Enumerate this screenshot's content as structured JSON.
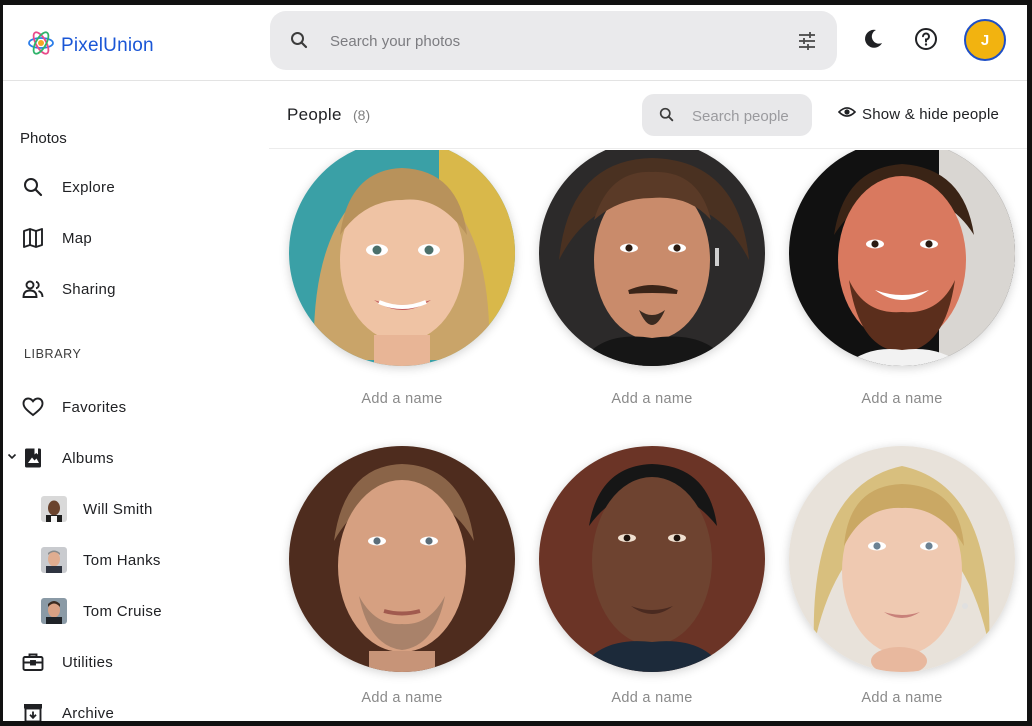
{
  "header": {
    "app_name": "PixelUnion",
    "search_placeholder": "Search your photos",
    "avatar_initial": "J",
    "icons": [
      "search-icon",
      "tune-icon",
      "dark-mode-icon",
      "help-icon"
    ]
  },
  "sidebar": {
    "photos_label": "Photos",
    "items": [
      {
        "label": "Explore",
        "icon": "search-icon"
      },
      {
        "label": "Map",
        "icon": "map-icon"
      },
      {
        "label": "Sharing",
        "icon": "people-icon"
      }
    ],
    "library_label": "LIBRARY",
    "library_items": [
      {
        "label": "Favorites",
        "icon": "heart-icon"
      },
      {
        "label": "Albums",
        "icon": "album-icon"
      }
    ],
    "albums": [
      {
        "label": "Will Smith"
      },
      {
        "label": "Tom Hanks"
      },
      {
        "label": "Tom Cruise"
      }
    ],
    "bottom_items": [
      {
        "label": "Utilities",
        "icon": "toolbox-icon"
      },
      {
        "label": "Archive",
        "icon": "archive-icon"
      }
    ]
  },
  "toolbar": {
    "title": "People",
    "count": "(8)",
    "search_placeholder": "Search people",
    "show_hide_label": "Show & hide people"
  },
  "people": [
    {
      "name_placeholder": "Add a name"
    },
    {
      "name_placeholder": "Add a name"
    },
    {
      "name_placeholder": "Add a name"
    },
    {
      "name_placeholder": "Add a name"
    },
    {
      "name_placeholder": "Add a name"
    },
    {
      "name_placeholder": "Add a name"
    }
  ],
  "colors": {
    "brand": "#1a56d6",
    "avatar_bg": "#f2b310",
    "search_bg": "#eaeaec"
  }
}
